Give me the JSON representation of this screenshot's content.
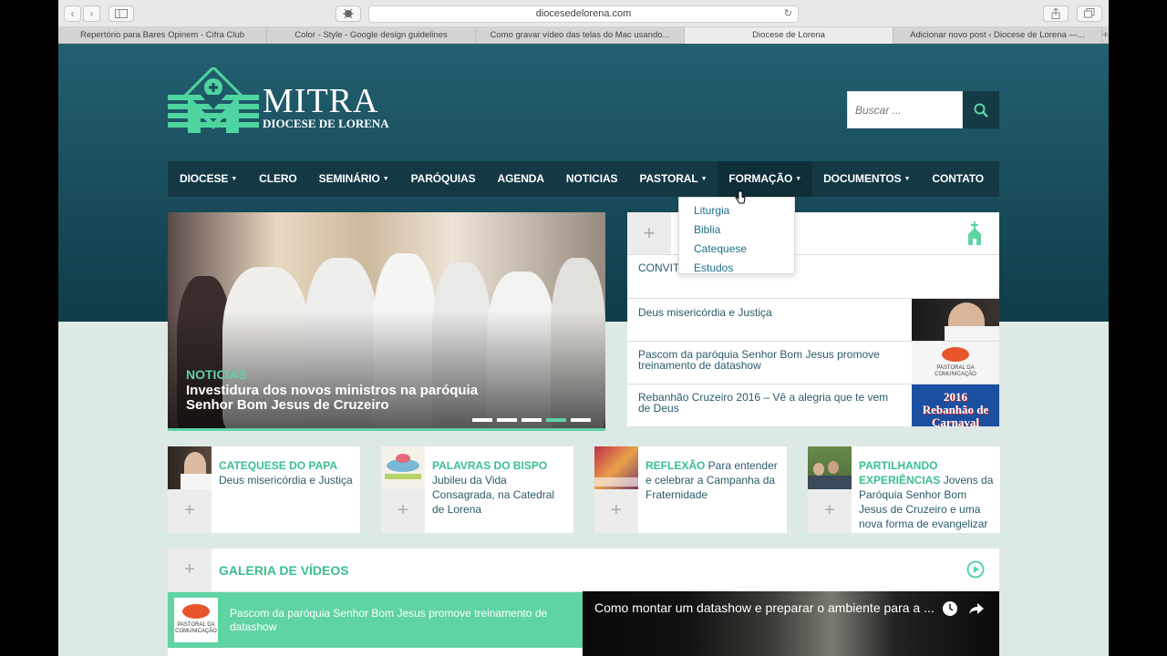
{
  "browser": {
    "url": "diocesedelorena.com",
    "tabs": [
      {
        "label": "Repertório para Bares Opinem - Cifra Club",
        "active": false
      },
      {
        "label": "Color - Style - Google design guidelines",
        "active": false
      },
      {
        "label": "Como gravar vídeo das telas do Mac usando...",
        "active": false
      },
      {
        "label": "Diocese de Lorena",
        "active": true
      },
      {
        "label": "Adicionar novo post ‹ Diocese de Lorena —...",
        "active": false
      }
    ],
    "new_tab": "+"
  },
  "site": {
    "logo_title": "MITRA",
    "logo_subtitle": "DIOCESE DE LORENA",
    "search_placeholder": "Buscar ...",
    "accent": "#5fd3a2",
    "header_color": "#1a4c5a"
  },
  "nav": {
    "items": [
      {
        "label": "DIOCESE",
        "caret": "▼"
      },
      {
        "label": "CLERO",
        "caret": ""
      },
      {
        "label": "SEMINÁRIO",
        "caret": "▼"
      },
      {
        "label": "PARÓQUIAS",
        "caret": ""
      },
      {
        "label": "AGENDA",
        "caret": ""
      },
      {
        "label": "NOTICIAS",
        "caret": ""
      },
      {
        "label": "PASTORAL",
        "caret": "▼"
      },
      {
        "label": "FORMAÇÃO",
        "caret": "▼"
      },
      {
        "label": "DOCUMENTOS",
        "caret": "▼"
      },
      {
        "label": "CONTATO",
        "caret": ""
      }
    ],
    "dropdown": [
      "Liturgia",
      "Biblia",
      "Catequese",
      "Estudos"
    ]
  },
  "slider": {
    "category": "NOTICIAS",
    "title": "Investidura dos novos ministros na paróquia Senhor Bom Jesus de Cruzeiro",
    "active_dot": 3
  },
  "side_panel": {
    "plus": "+",
    "convite": "CONVITE",
    "items": [
      {
        "text": "Deus misericórdia e Justiça"
      },
      {
        "text": "Pascom da paróquia Senhor Bom Jesus promove treinamento de datashow"
      },
      {
        "text": "Rebanhão Cruzeiro 2016 – Vê a alegria que te vem de Deus"
      }
    ],
    "thumb_pascom": "PASTORAL DA COMUNICAÇÃO",
    "thumb_rebanhao": "2016 Rebanhão de Carnaval"
  },
  "cards": [
    {
      "tag": "CATEQUESE DO PAPA",
      "text": " Deus misericórdia e Justiça"
    },
    {
      "tag": "PALAVRAS DO BISPO",
      "text": " Jubileu da Vida Consagrada, na Catedral de Lorena"
    },
    {
      "tag": "REFLEXÃO",
      "text": " Para entender e celebrar a Campanha da Fraternidade"
    },
    {
      "tag": "PARTILHANDO EXPERIÊNCIAS",
      "text": " Jovens da Paróquia Senhor Bom Jesus de Cruzeiro e uma nova forma de evangelizar"
    }
  ],
  "videos": {
    "plus": "+",
    "title": "GALERIA DE VÍDEOS",
    "item": "Pascom da paróquia Senhor Bom Jesus promove treinamento de datashow",
    "thumb_label": "PASTORAL DA COMUNICAÇÃO",
    "player_title": "Como montar um datashow e preparar o ambiente para a ..."
  }
}
